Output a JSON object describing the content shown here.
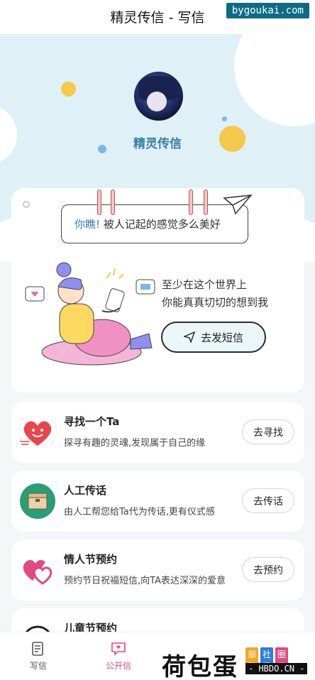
{
  "header": {
    "title": "精灵传信 - 写信"
  },
  "watermark": "bygoukai.com",
  "hero": {
    "app_name": "精灵传信"
  },
  "main_card": {
    "quote_accent": "你瞧!",
    "quote_text": "被人记起的感觉多么美好",
    "tagline_line1": "至少在这个世界上",
    "tagline_line2": "你能真真切切的想到我",
    "send_button": "去发短信"
  },
  "items": [
    {
      "title": "寻找一个Ta",
      "desc": "探寻有趣的灵魂,发现属于自己的缘",
      "button": "去寻找",
      "icon": "heart-face-icon"
    },
    {
      "title": "人工传话",
      "desc": "由人工帮您给Ta代为传话,更有仪式感",
      "button": "去传话",
      "icon": "package-box-icon"
    },
    {
      "title": "情人节预约",
      "desc": "预约节日祝福短信,向TA表达深深的爱意",
      "button": "去预约",
      "icon": "double-heart-icon"
    },
    {
      "title": "儿童节预约",
      "desc": "",
      "button": "",
      "icon": "clock-icon"
    }
  ],
  "tabbar": {
    "tabs": [
      {
        "label": "写信",
        "icon": "write-letter-icon",
        "active": false
      },
      {
        "label": "公开信",
        "icon": "message-bubble-icon",
        "active": true
      }
    ]
  },
  "brand": {
    "name": "荷包蛋",
    "tags": [
      "部落",
      "社区",
      "圈子"
    ],
    "domain": "- HBDO.CN -"
  },
  "colors": {
    "accent": "#3a7ea6",
    "active_tab": "#e24a7f",
    "hero_bg": "#dff1f6"
  }
}
